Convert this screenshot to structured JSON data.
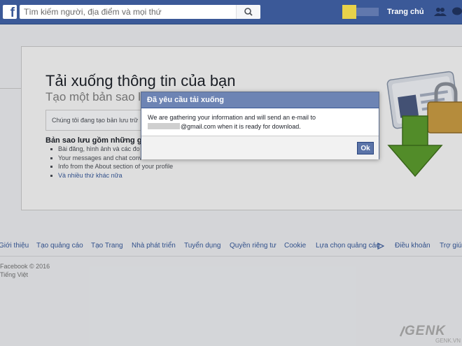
{
  "header": {
    "logo_letter": "f",
    "search_placeholder": "Tìm kiếm người, địa điểm và mọi thứ",
    "home_label": "Trang chủ"
  },
  "page": {
    "title": "Tải xuống thông tin của bạn",
    "subtitle": "Tạo một bản sao lưu",
    "status_text": "Chúng tôi đang tạo bản lưu trữ",
    "contents_heading": "Bản sao lưu gồm những g",
    "contents_items": [
      "Bài đăng, hình ảnh và các đo",
      "Your messages and chat conv",
      "Info from the About section of your profile",
      "Và nhiều thứ khác nữa"
    ]
  },
  "dialog": {
    "title": "Đã yêu cầu tải xuống",
    "line1": "We are gathering your information and will send an e-mail to",
    "line2": "@gmail.com when it is ready for download.",
    "ok_label": "Ok"
  },
  "footer": {
    "links": [
      "Giới thiệu",
      "Tạo quảng cáo",
      "Tạo Trang",
      "Nhà phát triển",
      "Tuyển dụng",
      "Quyền riêng tư",
      "Cookie",
      "Lựa chọn quảng cáo",
      "Điều khoản",
      "Trợ giúp"
    ],
    "copyright": "Facebook © 2016",
    "language": "Tiếng Việt"
  },
  "watermark": {
    "brand": "GENK",
    "domain": "GENK.VN"
  },
  "colors": {
    "brand_blue": "#3b5998",
    "dialog_header": "#6d84b4",
    "arrow_green": "#5b9a2e",
    "lock_gold": "#c79a43"
  }
}
